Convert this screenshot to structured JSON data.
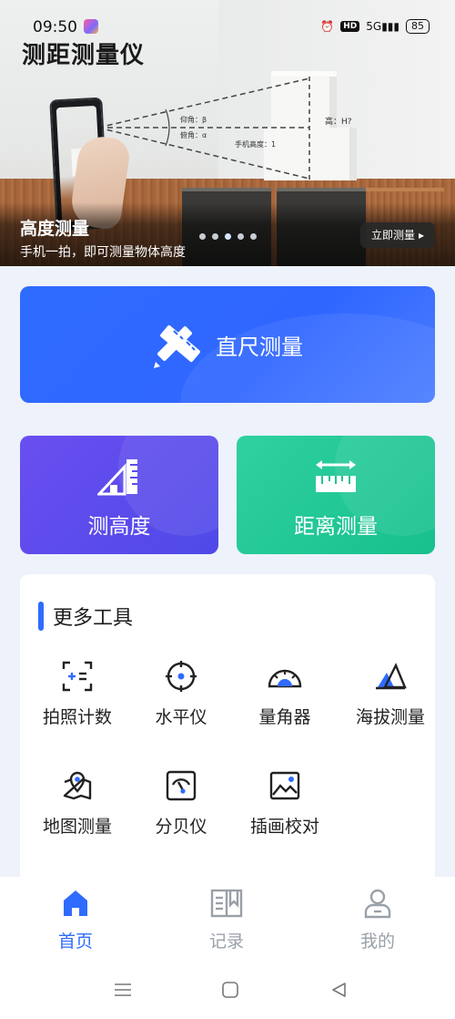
{
  "status_bar": {
    "time": "09:50",
    "hd_label": "HD",
    "network": "5G",
    "battery": "85"
  },
  "app": {
    "title": "测距测量仪"
  },
  "banner": {
    "title": "高度测量",
    "subtitle": "手机一拍，即可测量物体高度",
    "cta_label": "立即测量",
    "diagram_labels": {
      "elevation": "仰角：β",
      "depression": "俯角：α",
      "phone_height": "手机高度：1",
      "target_height": "高：H?"
    },
    "carousel_count": 5,
    "carousel_active_index": 3
  },
  "primary": {
    "ruler_label": "直尺测量",
    "height_label": "测高度",
    "distance_label": "距离测量"
  },
  "more_tools": {
    "title": "更多工具",
    "items": [
      {
        "label": "拍照计数",
        "icon": "photo-count-icon"
      },
      {
        "label": "水平仪",
        "icon": "level-icon"
      },
      {
        "label": "量角器",
        "icon": "protractor-icon"
      },
      {
        "label": "海拔测量",
        "icon": "altitude-icon"
      },
      {
        "label": "地图测量",
        "icon": "map-icon"
      },
      {
        "label": "分贝仪",
        "icon": "decibel-icon"
      },
      {
        "label": "插画校对",
        "icon": "image-check-icon"
      }
    ]
  },
  "nav": {
    "items": [
      {
        "label": "首页",
        "icon": "home-icon",
        "active": true
      },
      {
        "label": "记录",
        "icon": "record-icon",
        "active": false
      },
      {
        "label": "我的",
        "icon": "profile-icon",
        "active": false
      }
    ]
  },
  "colors": {
    "accent": "#2f6bff",
    "purple": "#5a4bec",
    "green": "#1fc594",
    "page_bg": "#eef2fa"
  }
}
